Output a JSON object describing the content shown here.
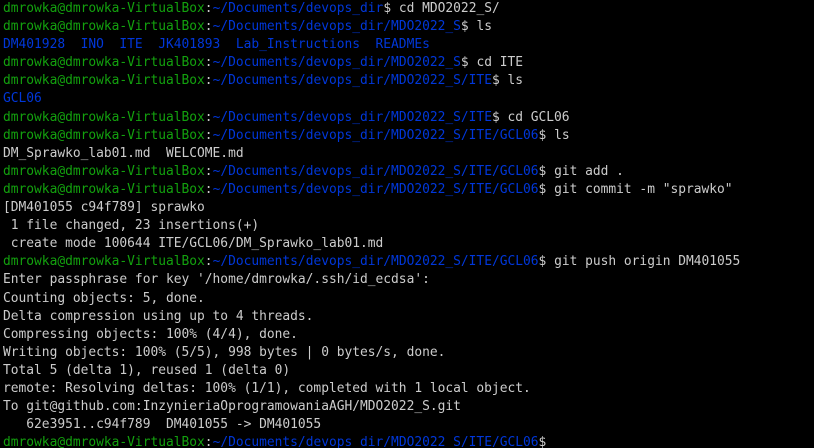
{
  "terminal": {
    "colors": {
      "background": "#000000",
      "prompt_user": "#13a10e",
      "prompt_path": "#0037da",
      "text": "#cccccc",
      "directory_listing": "#0037da"
    },
    "prompt_user": "dmrowka@dmrowka-VirtualBox",
    "lines": [
      {
        "type": "prompt",
        "path": "~/Documents/devops_dir",
        "command": "cd MDO2022_S/"
      },
      {
        "type": "prompt",
        "path": "~/Documents/devops_dir/MDO2022_S",
        "command": "ls"
      },
      {
        "type": "dirlist",
        "text": "DM401928  INO  ITE  JK401893  Lab_Instructions  READMEs"
      },
      {
        "type": "prompt",
        "path": "~/Documents/devops_dir/MDO2022_S",
        "command": "cd ITE"
      },
      {
        "type": "prompt",
        "path": "~/Documents/devops_dir/MDO2022_S/ITE",
        "command": "ls"
      },
      {
        "type": "dirlist",
        "text": "GCL06"
      },
      {
        "type": "prompt",
        "path": "~/Documents/devops_dir/MDO2022_S/ITE",
        "command": "cd GCL06"
      },
      {
        "type": "prompt",
        "path": "~/Documents/devops_dir/MDO2022_S/ITE/GCL06",
        "command": "ls"
      },
      {
        "type": "output",
        "text": "DM_Sprawko_lab01.md  WELCOME.md"
      },
      {
        "type": "prompt",
        "path": "~/Documents/devops_dir/MDO2022_S/ITE/GCL06",
        "command": "git add ."
      },
      {
        "type": "prompt",
        "path": "~/Documents/devops_dir/MDO2022_S/ITE/GCL06",
        "command": "git commit -m \"sprawko\""
      },
      {
        "type": "output",
        "text": "[DM401055 c94f789] sprawko"
      },
      {
        "type": "output",
        "text": " 1 file changed, 23 insertions(+)"
      },
      {
        "type": "output",
        "text": " create mode 100644 ITE/GCL06/DM_Sprawko_lab01.md"
      },
      {
        "type": "prompt",
        "path": "~/Documents/devops_dir/MDO2022_S/ITE/GCL06",
        "command": "git push origin DM401055"
      },
      {
        "type": "output",
        "text": "Enter passphrase for key '/home/dmrowka/.ssh/id_ecdsa':"
      },
      {
        "type": "output",
        "text": "Counting objects: 5, done."
      },
      {
        "type": "output",
        "text": "Delta compression using up to 4 threads."
      },
      {
        "type": "output",
        "text": "Compressing objects: 100% (4/4), done."
      },
      {
        "type": "output",
        "text": "Writing objects: 100% (5/5), 998 bytes | 0 bytes/s, done."
      },
      {
        "type": "output",
        "text": "Total 5 (delta 1), reused 1 (delta 0)"
      },
      {
        "type": "output",
        "text": "remote: Resolving deltas: 100% (1/1), completed with 1 local object."
      },
      {
        "type": "output",
        "text": "To git@github.com:InzynieriaOprogramowaniaAGH/MDO2022_S.git"
      },
      {
        "type": "output",
        "text": "   62e3951..c94f789  DM401055 -> DM401055"
      },
      {
        "type": "prompt",
        "path": "~/Documents/devops_dir/MDO2022_S/ITE/GCL06",
        "command": ""
      }
    ]
  }
}
